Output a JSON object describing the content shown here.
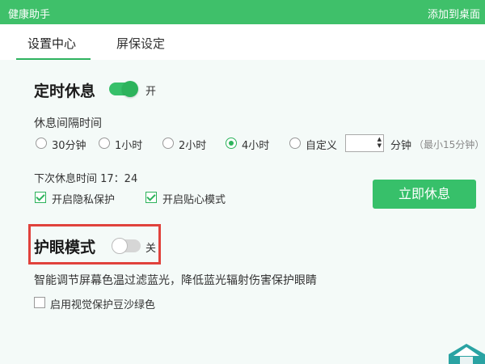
{
  "window": {
    "title": "健康助手",
    "add_to_desktop": "添加到桌面"
  },
  "tabs": [
    {
      "label": "设置中心",
      "active": true
    },
    {
      "label": "屏保设定",
      "active": false
    }
  ],
  "timed_rest": {
    "title": "定时休息",
    "toggle_state": "开",
    "enabled": true,
    "interval_label": "休息间隔时间",
    "options": [
      "30分钟",
      "1小时",
      "2小时",
      "4小时",
      "自定义"
    ],
    "selected_index": 3,
    "custom_unit": "分钟",
    "custom_hint": "（最小15分钟）",
    "next_rest": "下次休息时间 17：24",
    "privacy_label": "开启隐私保护",
    "privacy_checked": true,
    "care_label": "开启贴心模式",
    "care_checked": true,
    "rest_now_button": "立即休息"
  },
  "eye_care": {
    "title": "护眼模式",
    "toggle_state": "关",
    "enabled": false,
    "description": "智能调节屏幕色温过滤蓝光，降低蓝光辐射伤害保护眼睛",
    "bean_green_label": "启用视觉保护豆沙绿色",
    "bean_green_checked": false
  },
  "colors": {
    "accent": "#37c06a",
    "title_bar": "#3fc06a",
    "highlight": "#e0423c"
  }
}
